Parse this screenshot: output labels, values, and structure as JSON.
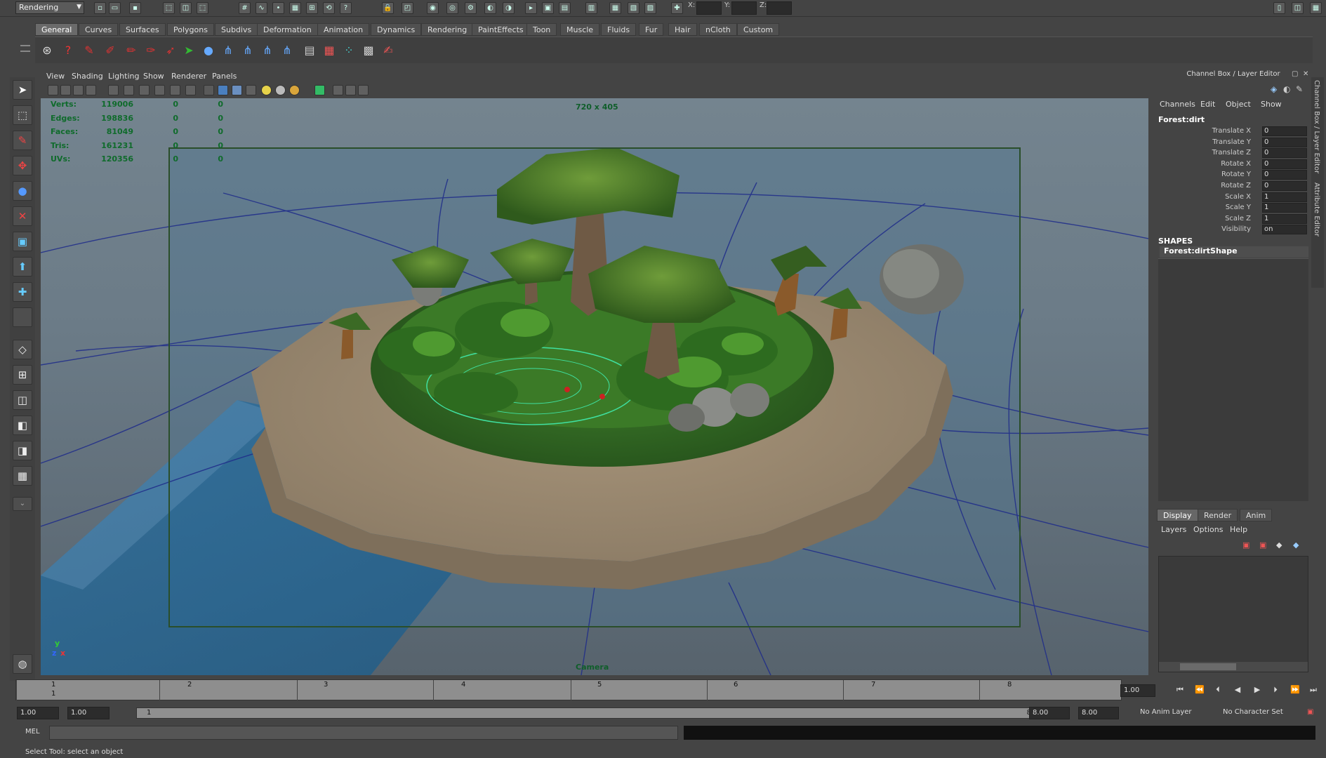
{
  "top_toolbar": {
    "mode": "Rendering",
    "coord_labels": {
      "x": "X:",
      "y": "Y:",
      "z": "Z:"
    }
  },
  "shelf": {
    "tabs": [
      "General",
      "Curves",
      "Surfaces",
      "Polygons",
      "Subdivs",
      "Deformation",
      "Animation",
      "Dynamics",
      "Rendering",
      "PaintEffects",
      "Toon",
      "Muscle",
      "Fluids",
      "Fur",
      "Hair",
      "nCloth",
      "Custom"
    ],
    "active_tab": "General"
  },
  "viewport": {
    "menu": [
      "View",
      "Shading",
      "Lighting",
      "Show",
      "Renderer",
      "Panels"
    ],
    "resolution": "720 x 405",
    "camera": "Camera",
    "stats": [
      {
        "label": "Verts:",
        "value": "119006",
        "sel": "0",
        "comp": "0"
      },
      {
        "label": "Edges:",
        "value": "198836",
        "sel": "0",
        "comp": "0"
      },
      {
        "label": "Faces:",
        "value": "81049",
        "sel": "0",
        "comp": "0"
      },
      {
        "label": "Tris:",
        "value": "161231",
        "sel": "0",
        "comp": "0"
      },
      {
        "label": "UVs:",
        "value": "120356",
        "sel": "0",
        "comp": "0"
      }
    ],
    "axis": {
      "y": "y",
      "z": "z",
      "x": "x"
    }
  },
  "channel_box": {
    "title": "Channel Box / Layer Editor",
    "menu": [
      "Channels",
      "Edit",
      "Object",
      "Show"
    ],
    "object": "Forest:dirt",
    "attributes": [
      {
        "name": "Translate X",
        "value": "0"
      },
      {
        "name": "Translate Y",
        "value": "0"
      },
      {
        "name": "Translate Z",
        "value": "0"
      },
      {
        "name": "Rotate X",
        "value": "0"
      },
      {
        "name": "Rotate Y",
        "value": "0"
      },
      {
        "name": "Rotate Z",
        "value": "0"
      },
      {
        "name": "Scale X",
        "value": "1"
      },
      {
        "name": "Scale Y",
        "value": "1"
      },
      {
        "name": "Scale Z",
        "value": "1"
      },
      {
        "name": "Visibility",
        "value": "on"
      }
    ],
    "shapes_header": "SHAPES",
    "shape": "Forest:dirtShape"
  },
  "layer_editor": {
    "tabs": [
      "Display",
      "Render",
      "Anim"
    ],
    "active_tab": "Display",
    "menu": [
      "Layers",
      "Options",
      "Help"
    ]
  },
  "side_tabs": [
    "Channel Box / Layer Editor",
    "Attribute Editor"
  ],
  "timeline": {
    "ticks": [
      "1",
      "2",
      "3",
      "4",
      "5",
      "6",
      "7",
      "8"
    ],
    "current": "1",
    "current_frame_field": "1.00"
  },
  "range": {
    "start": "1.00",
    "playback_start": "1.00",
    "slider_start": "1",
    "slider_end": "8",
    "playback_end": "8.00",
    "end": "8.00",
    "anim_layer": "No Anim Layer",
    "character_set": "No Character Set"
  },
  "command_line": {
    "label": "MEL"
  },
  "status": "Select Tool: select an object"
}
